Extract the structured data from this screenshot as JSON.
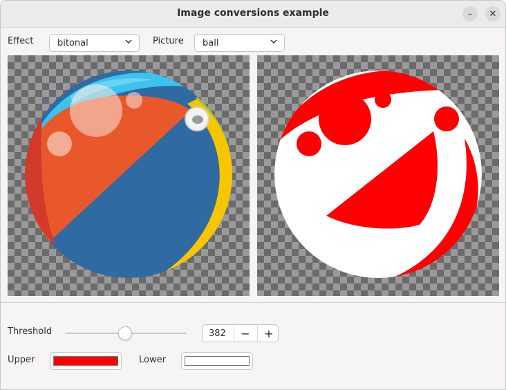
{
  "window": {
    "title": "Image conversions example"
  },
  "controls": {
    "effect_label": "Effect",
    "effect_value": "bitonal",
    "picture_label": "Picture",
    "picture_value": "ball"
  },
  "threshold": {
    "label": "Threshold",
    "value": "382",
    "slider_fraction": 0.49
  },
  "colors": {
    "upper_label": "Upper",
    "upper_color": "#ff0000",
    "lower_label": "Lower",
    "lower_color": "#ffffff"
  },
  "icons": {
    "minimize": "minimize-icon",
    "close": "close-icon",
    "chevron": "chevron-down-icon",
    "minus": "minus-icon",
    "plus": "plus-icon"
  }
}
